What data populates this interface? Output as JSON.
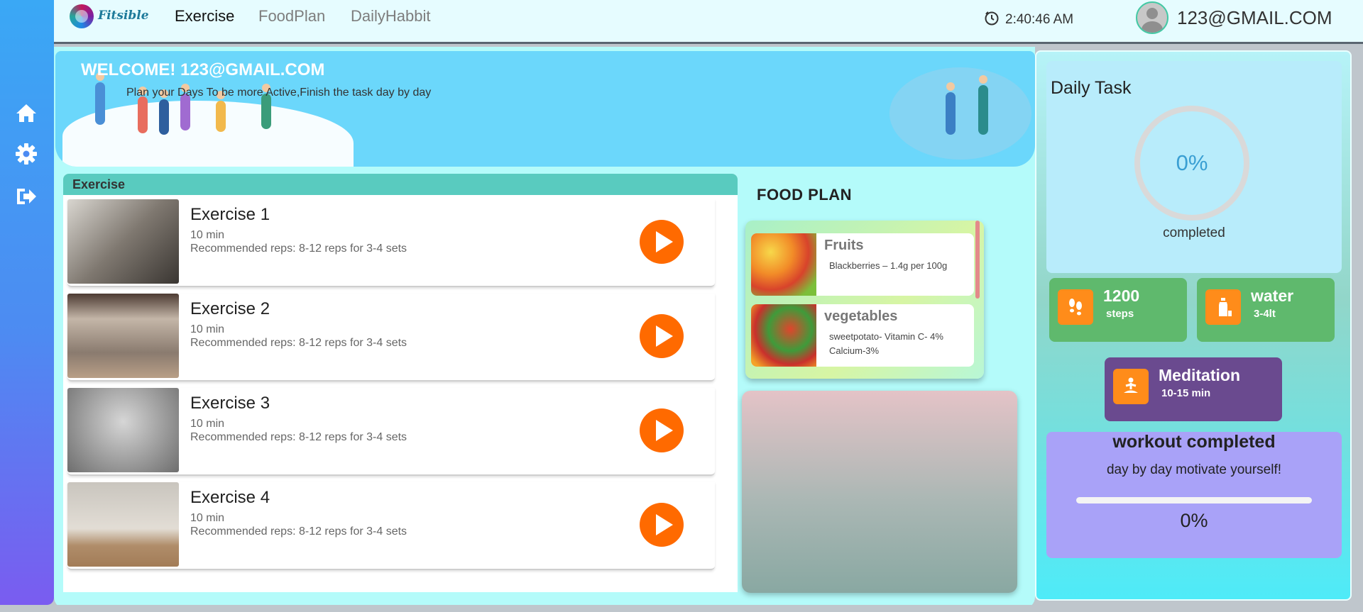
{
  "app": {
    "logo_text": "Fitsible",
    "nav": [
      "Exercise",
      "FoodPlan",
      "DailyHabbit"
    ],
    "active_nav": "Exercise",
    "time": "2:40:46 AM",
    "user_email": "123@GMAIL.COM"
  },
  "sidebar": {
    "icons": [
      "home-icon",
      "gear-icon",
      "logout-icon"
    ]
  },
  "banner": {
    "welcome": "WELCOME! 123@GMAIL.COM",
    "subtitle": "Plan your Days To be more Active,Finish the task day by day"
  },
  "exercise": {
    "header": "Exercise",
    "items": [
      {
        "name": "Exercise 1",
        "duration": "10 min",
        "reps": "Recommended reps: 8-12 reps for 3-4 sets"
      },
      {
        "name": "Exercise 2",
        "duration": "10 min",
        "reps": "Recommended reps: 8-12 reps for 3-4 sets"
      },
      {
        "name": "Exercise 3",
        "duration": "10 min",
        "reps": "Recommended reps: 8-12 reps for 3-4 sets"
      },
      {
        "name": "Exercise 4",
        "duration": "10 min",
        "reps": "Recommended reps: 8-12 reps for 3-4 sets"
      }
    ]
  },
  "food_plan": {
    "title": "FOOD PLAN",
    "items": [
      {
        "name": "Fruits",
        "desc": "Blackberries – 1.4g per 100g"
      },
      {
        "name": "vegetables",
        "desc": "sweetpotato- Vitamin C- 4% Calcium-3%"
      }
    ]
  },
  "daily_task": {
    "title": "Daily Task",
    "percent": "0%",
    "progress": 0,
    "label": "completed"
  },
  "stats": {
    "steps": {
      "value": "1200",
      "label": "steps"
    },
    "water": {
      "value": "water",
      "label": "3-4lt"
    },
    "meditation": {
      "value": "Meditation",
      "label": "10-15 min"
    }
  },
  "workout": {
    "title": "workout completed",
    "subtitle": "day by day motivate yourself!",
    "percent": "0%",
    "progress": 0
  },
  "colors": {
    "accent_orange": "#ff6a00",
    "header_teal": "#59cbbf",
    "banner_blue": "#6bd7fb",
    "steps_green": "#5fb96d",
    "meditation_purple": "#6a4a8f",
    "workout_lavender": "#a9a2f8"
  }
}
